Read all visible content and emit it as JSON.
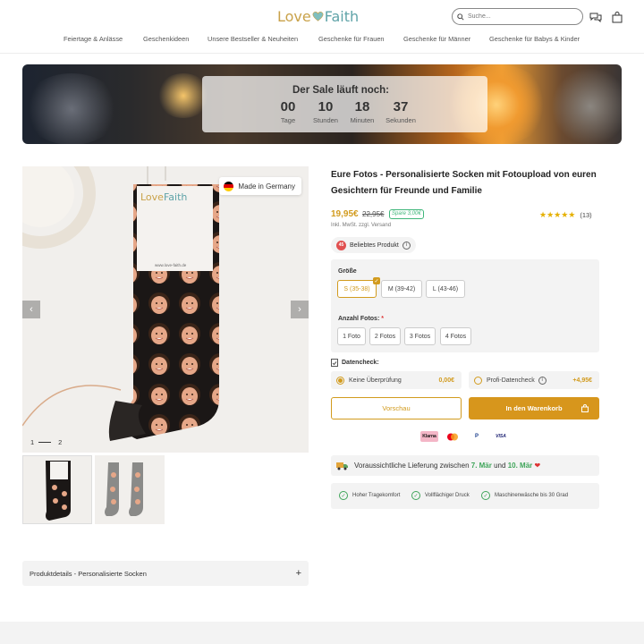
{
  "header": {
    "logo_love": "Love",
    "logo_faith": "Faith",
    "search_placeholder": "Suche...",
    "icons": [
      "search-icon",
      "chat-icon",
      "bag-icon"
    ]
  },
  "nav": {
    "items": [
      "Feiertage & Anlässe",
      "Geschenkideen",
      "Unsere Bestseller & Neuheiten",
      "Geschenke für Frauen",
      "Geschenke für Männer",
      "Geschenke für Babys & Kinder"
    ]
  },
  "banner": {
    "title": "Der Sale läuft noch:",
    "countdown": [
      {
        "value": "00",
        "label": "Tage"
      },
      {
        "value": "10",
        "label": "Stunden"
      },
      {
        "value": "18",
        "label": "Minuten"
      },
      {
        "value": "37",
        "label": "Sekunden"
      }
    ]
  },
  "gallery": {
    "made_in": "Made in Germany",
    "card_logo_love": "Love",
    "card_logo_faith": "Faith",
    "card_url": "www.love-faith.de",
    "pager_current": "1",
    "pager_next": "2",
    "prev": "‹",
    "next": "›"
  },
  "product_details": {
    "label": "Produktdetails - Personalisierte Socken",
    "toggle": "+"
  },
  "product": {
    "title": "Eure Fotos - Personalisierte Socken mit Fotoupload von euren Gesichtern für Freunde und Familie",
    "price": "19,95€",
    "old_price": "22,95€",
    "save": "Spare 3,00€",
    "tax": "Inkl. MwSt. zzgl. Versand",
    "stars": "★★★★★",
    "rating_count": "(13)",
    "popular_label": "Beliebtes Produkt",
    "popular_badge": "45"
  },
  "options": {
    "size_label": "Größe",
    "sizes": [
      {
        "label": "S (35-38)",
        "selected": true
      },
      {
        "label": "M (39-42)",
        "selected": false
      },
      {
        "label": "L (43-46)",
        "selected": false
      }
    ],
    "photos_label": "Anzahl Fotos:",
    "photos_required": "*",
    "photos": [
      "1 Foto",
      "2 Fotos",
      "3 Fotos",
      "4 Fotos"
    ]
  },
  "datacheck": {
    "label": "Datencheck:",
    "options": [
      {
        "label": "Keine Überprüfung",
        "price": "0,00€",
        "selected": true
      },
      {
        "label": "Profi-Datencheck",
        "price": "+4,95€",
        "selected": false
      }
    ]
  },
  "actions": {
    "preview": "Vorschau",
    "add_to_cart": "In den Warenkorb"
  },
  "payments": [
    "Klarna",
    "",
    "P",
    "VISA"
  ],
  "delivery": {
    "text_before": "Voraussichtliche Lieferung zwischen",
    "date1": "7. Mär",
    "text_mid": "und",
    "date2": "10. Mär",
    "heart": "❤"
  },
  "features": [
    "Hoher Tragekomfort",
    "Vollflächiger Druck",
    "Maschinenwäsche bis 30 Grad"
  ],
  "colors": {
    "accent": "#d7961c",
    "green": "#3fa55a",
    "teal": "#5fa3a8"
  }
}
